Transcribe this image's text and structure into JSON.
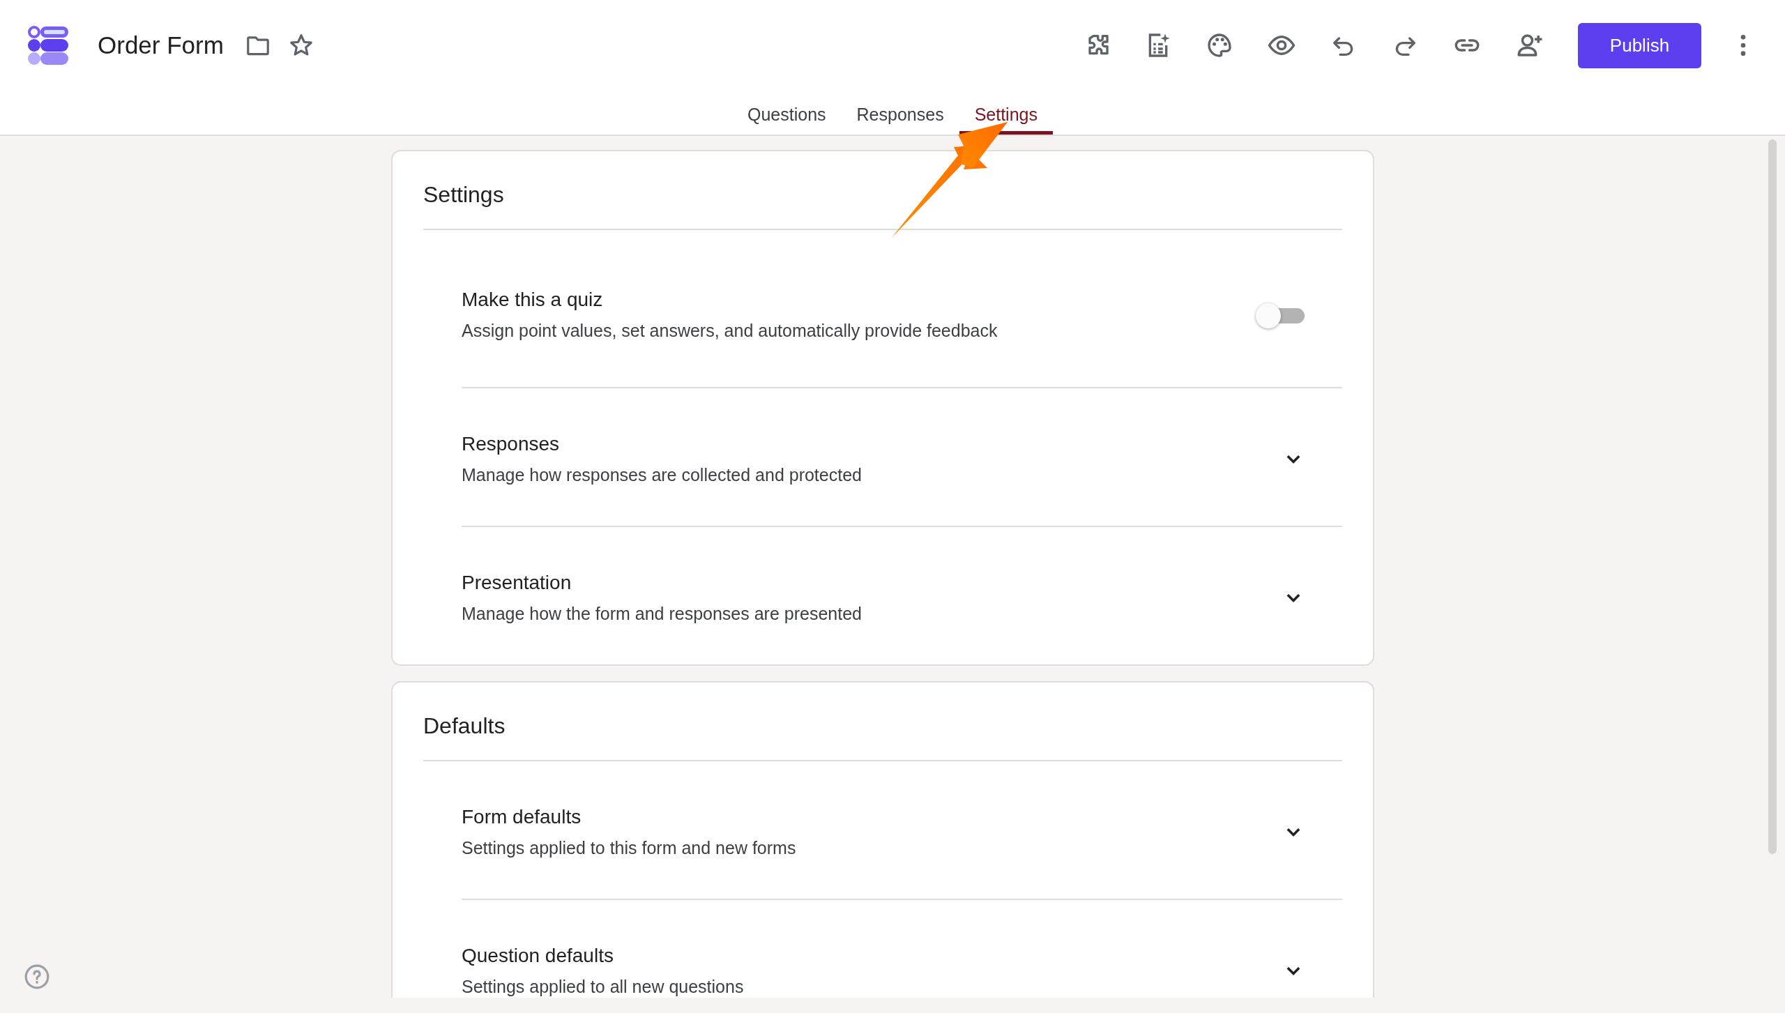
{
  "header": {
    "title": "Order Form",
    "publish_button": "Publish"
  },
  "tabs": [
    {
      "label": "Questions",
      "selected": false
    },
    {
      "label": "Responses",
      "selected": false
    },
    {
      "label": "Settings",
      "selected": true
    }
  ],
  "cards": [
    {
      "title": "Settings",
      "items": [
        {
          "kind": "toggle",
          "title": "Make this a quiz",
          "description": "Assign point values, set answers, and automatically provide feedback",
          "on": false
        },
        {
          "kind": "expand",
          "title": "Responses",
          "description": "Manage how responses are collected and protected",
          "expanded": false
        },
        {
          "kind": "expand",
          "title": "Presentation",
          "description": "Manage how the form and responses are presented",
          "expanded": false
        }
      ]
    },
    {
      "title": "Defaults",
      "items": [
        {
          "kind": "expand",
          "title": "Form defaults",
          "description": "Settings applied to this form and new forms",
          "expanded": false
        },
        {
          "kind": "expand",
          "title": "Question defaults",
          "description": "Settings applied to all new questions",
          "expanded": false
        }
      ]
    }
  ]
}
